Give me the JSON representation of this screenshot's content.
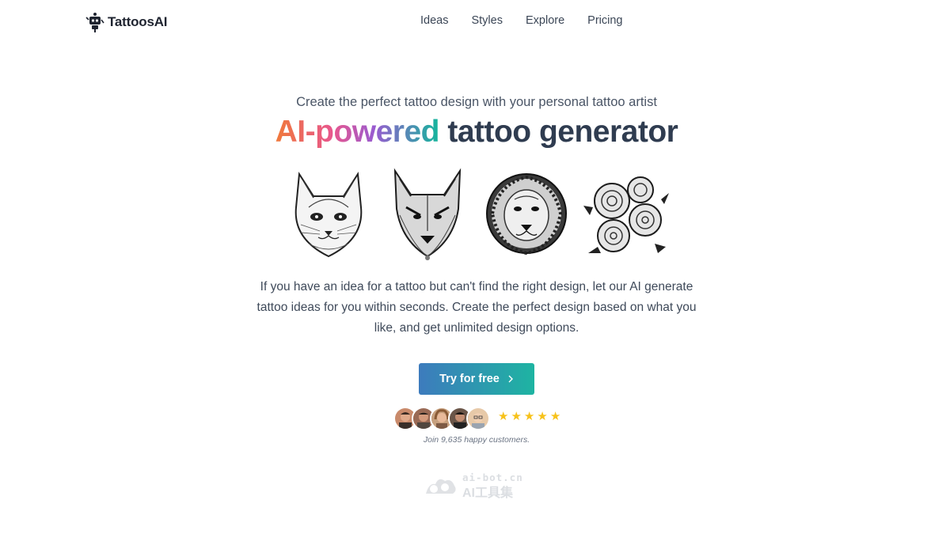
{
  "nav": {
    "logo_text": "TattoosAI",
    "links": [
      "Ideas",
      "Styles",
      "Explore",
      "Pricing"
    ]
  },
  "hero": {
    "subtitle": "Create the perfect tattoo design with your personal tattoo artist",
    "headline_gradient": "AI-powered",
    "headline_rest": " tattoo generator",
    "gallery": [
      "cat tattoo design",
      "wolf tattoo design",
      "lion tattoo design",
      "roses tattoo design"
    ],
    "description": "If you have an idea for a tattoo but can't find the right design, let our AI generate tattoo ideas for you within seconds. Create the perfect design based on what you like, and get unlimited design options.",
    "cta_label": "Try for free",
    "cta_icon": "chevron-right-icon",
    "rating_stars": 5,
    "social_proof": "Join 9,635 happy customers."
  },
  "watermark": {
    "line1": "ai-bot.cn",
    "line2": "AI工具集"
  },
  "colors": {
    "gradient": [
      "#f0793a",
      "#e8568e",
      "#9a5bd0",
      "#13b69c"
    ],
    "cta_gradient": [
      "#3d7bbd",
      "#1eb4a2"
    ],
    "star": "#f7c21a",
    "heading": "#2f3c50"
  }
}
